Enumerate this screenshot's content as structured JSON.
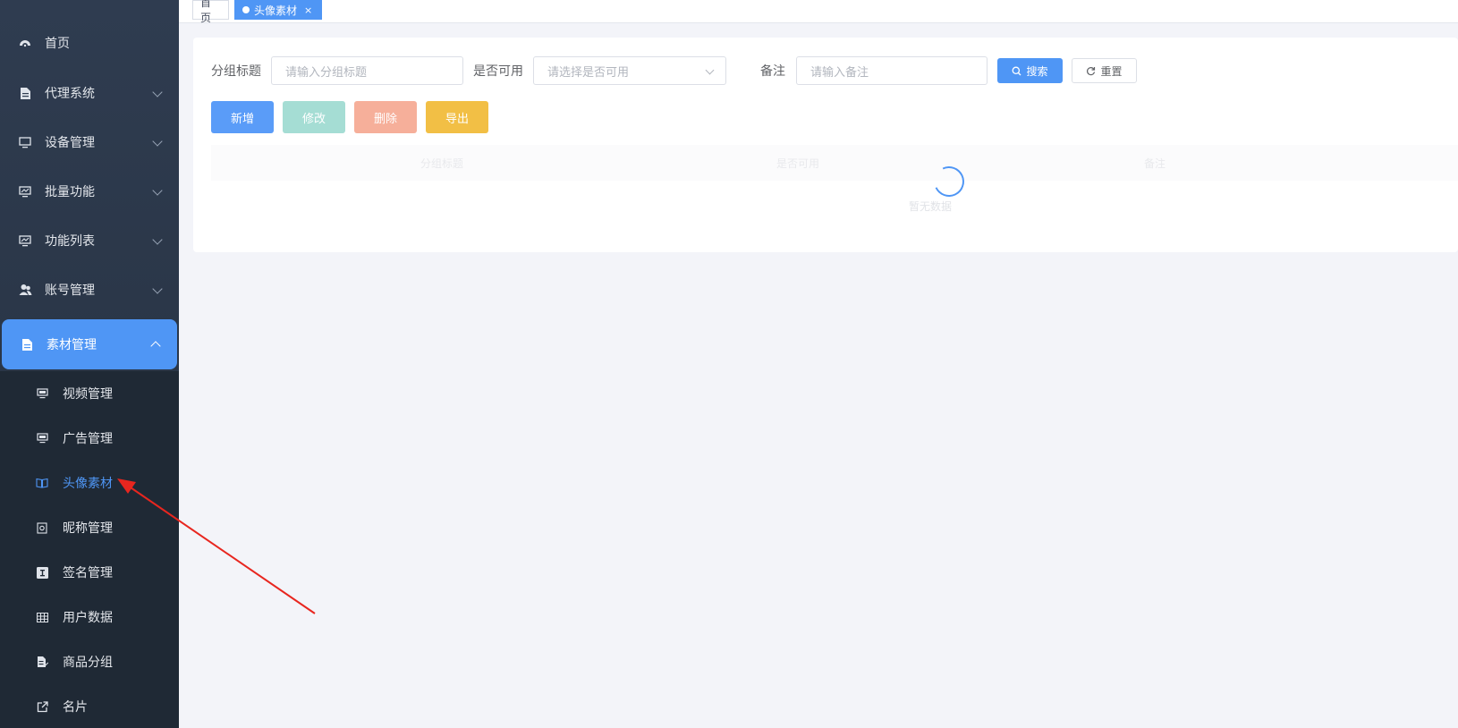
{
  "sidebar": {
    "items": [
      {
        "label": "首页",
        "icon": "dashboard-icon"
      },
      {
        "label": "代理系统",
        "icon": "document-icon"
      },
      {
        "label": "设备管理",
        "icon": "monitor-icon"
      },
      {
        "label": "批量功能",
        "icon": "chart-monitor-icon"
      },
      {
        "label": "功能列表",
        "icon": "chart-monitor-icon"
      },
      {
        "label": "账号管理",
        "icon": "users-icon"
      },
      {
        "label": "素材管理",
        "icon": "document-icon"
      }
    ],
    "submenu": [
      {
        "label": "视频管理",
        "icon": "monitor-icon"
      },
      {
        "label": "广告管理",
        "icon": "monitor-icon"
      },
      {
        "label": "头像素材",
        "icon": "book-icon"
      },
      {
        "label": "昵称管理",
        "icon": "safe-icon"
      },
      {
        "label": "签名管理",
        "icon": "text-icon"
      },
      {
        "label": "用户数据",
        "icon": "table-icon"
      },
      {
        "label": "商品分组",
        "icon": "edit-doc-icon"
      },
      {
        "label": "名片",
        "icon": "external-link-icon"
      }
    ]
  },
  "tabs": [
    {
      "label": "首页"
    },
    {
      "label": "头像素材",
      "close": "×"
    }
  ],
  "filters": {
    "group_title_label": "分组标题",
    "group_title_placeholder": "请输入分组标题",
    "available_label": "是否可用",
    "available_placeholder": "请选择是否可用",
    "remark_label": "备注",
    "remark_placeholder": "请输入备注",
    "search_label": "搜索",
    "reset_label": "重置"
  },
  "actions": {
    "add": "新增",
    "edit": "修改",
    "delete": "删除",
    "export": "导出"
  },
  "table": {
    "columns": [
      "分组标题",
      "是否可用",
      "备注"
    ],
    "empty_text": "暂无数据"
  },
  "colors": {
    "primary": "#4f96f5",
    "sidebar": "#2f3c50",
    "submenu": "#1f2935"
  }
}
